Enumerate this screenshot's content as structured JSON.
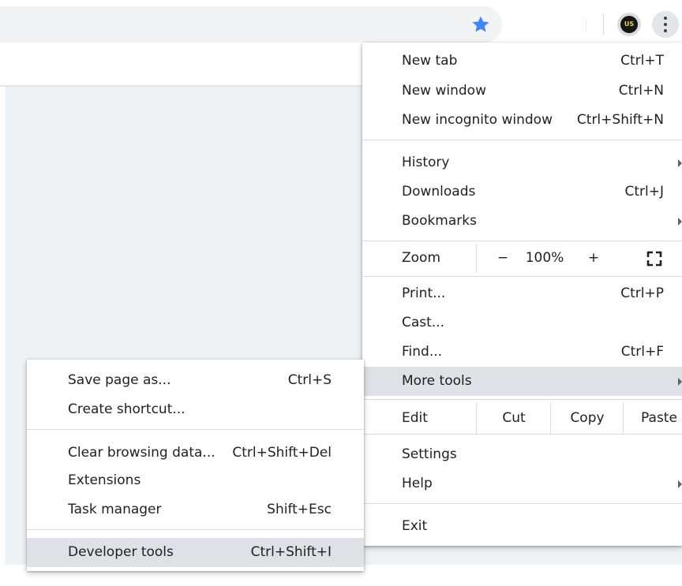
{
  "toolbar": {
    "icons": {
      "bookmark_star": "star-icon",
      "profile": "avatar",
      "menu": "kebab-menu-icon"
    },
    "avatar_text": "US",
    "accent_color": "#4285f4"
  },
  "main_menu": {
    "new_tab": {
      "label": "New tab",
      "shortcut": "Ctrl+T"
    },
    "new_window": {
      "label": "New window",
      "shortcut": "Ctrl+N"
    },
    "new_incognito": {
      "label": "New incognito window",
      "shortcut": "Ctrl+Shift+N"
    },
    "history": {
      "label": "History"
    },
    "downloads": {
      "label": "Downloads",
      "shortcut": "Ctrl+J"
    },
    "bookmarks": {
      "label": "Bookmarks"
    },
    "zoom": {
      "label": "Zoom",
      "minus": "−",
      "value": "100%",
      "plus": "+"
    },
    "print": {
      "label": "Print...",
      "shortcut": "Ctrl+P"
    },
    "cast": {
      "label": "Cast..."
    },
    "find": {
      "label": "Find...",
      "shortcut": "Ctrl+F"
    },
    "more_tools": {
      "label": "More tools"
    },
    "edit": {
      "label": "Edit",
      "cut": "Cut",
      "copy": "Copy",
      "paste": "Paste"
    },
    "settings": {
      "label": "Settings"
    },
    "help": {
      "label": "Help"
    },
    "exit": {
      "label": "Exit"
    }
  },
  "sub_menu": {
    "save_page": {
      "label": "Save page as...",
      "shortcut": "Ctrl+S"
    },
    "create_shortcut": {
      "label": "Create shortcut..."
    },
    "clear_data": {
      "label": "Clear browsing data...",
      "shortcut": "Ctrl+Shift+Del"
    },
    "extensions": {
      "label": "Extensions"
    },
    "task_manager": {
      "label": "Task manager",
      "shortcut": "Shift+Esc"
    },
    "dev_tools": {
      "label": "Developer tools",
      "shortcut": "Ctrl+Shift+I"
    }
  },
  "colors": {
    "highlight": "#dee1e6",
    "page_gray": "#eef2f5",
    "separator": "#dadce0"
  }
}
